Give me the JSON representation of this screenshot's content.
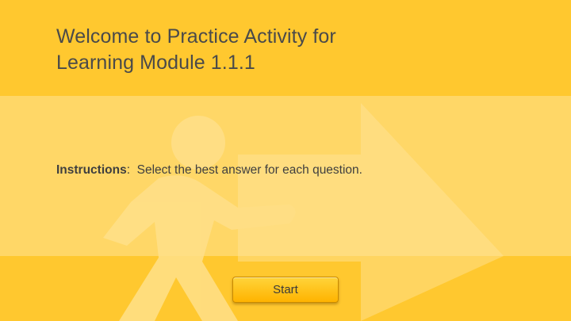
{
  "slide": {
    "title_line1": "Welcome to Practice Activity for",
    "title_line2": "Learning Module 1.1.1"
  },
  "instructions": {
    "label": "Instructions",
    "separator": ":",
    "text": "Select the best answer for each question."
  },
  "start_button": {
    "label": "Start"
  },
  "colors": {
    "background": "#FFC82F",
    "band": "#FFD767",
    "button_top": "#FFD43A",
    "button_bottom": "#FFB300"
  },
  "icons": {
    "background_illustration": "walking-person-arrow-icon"
  }
}
